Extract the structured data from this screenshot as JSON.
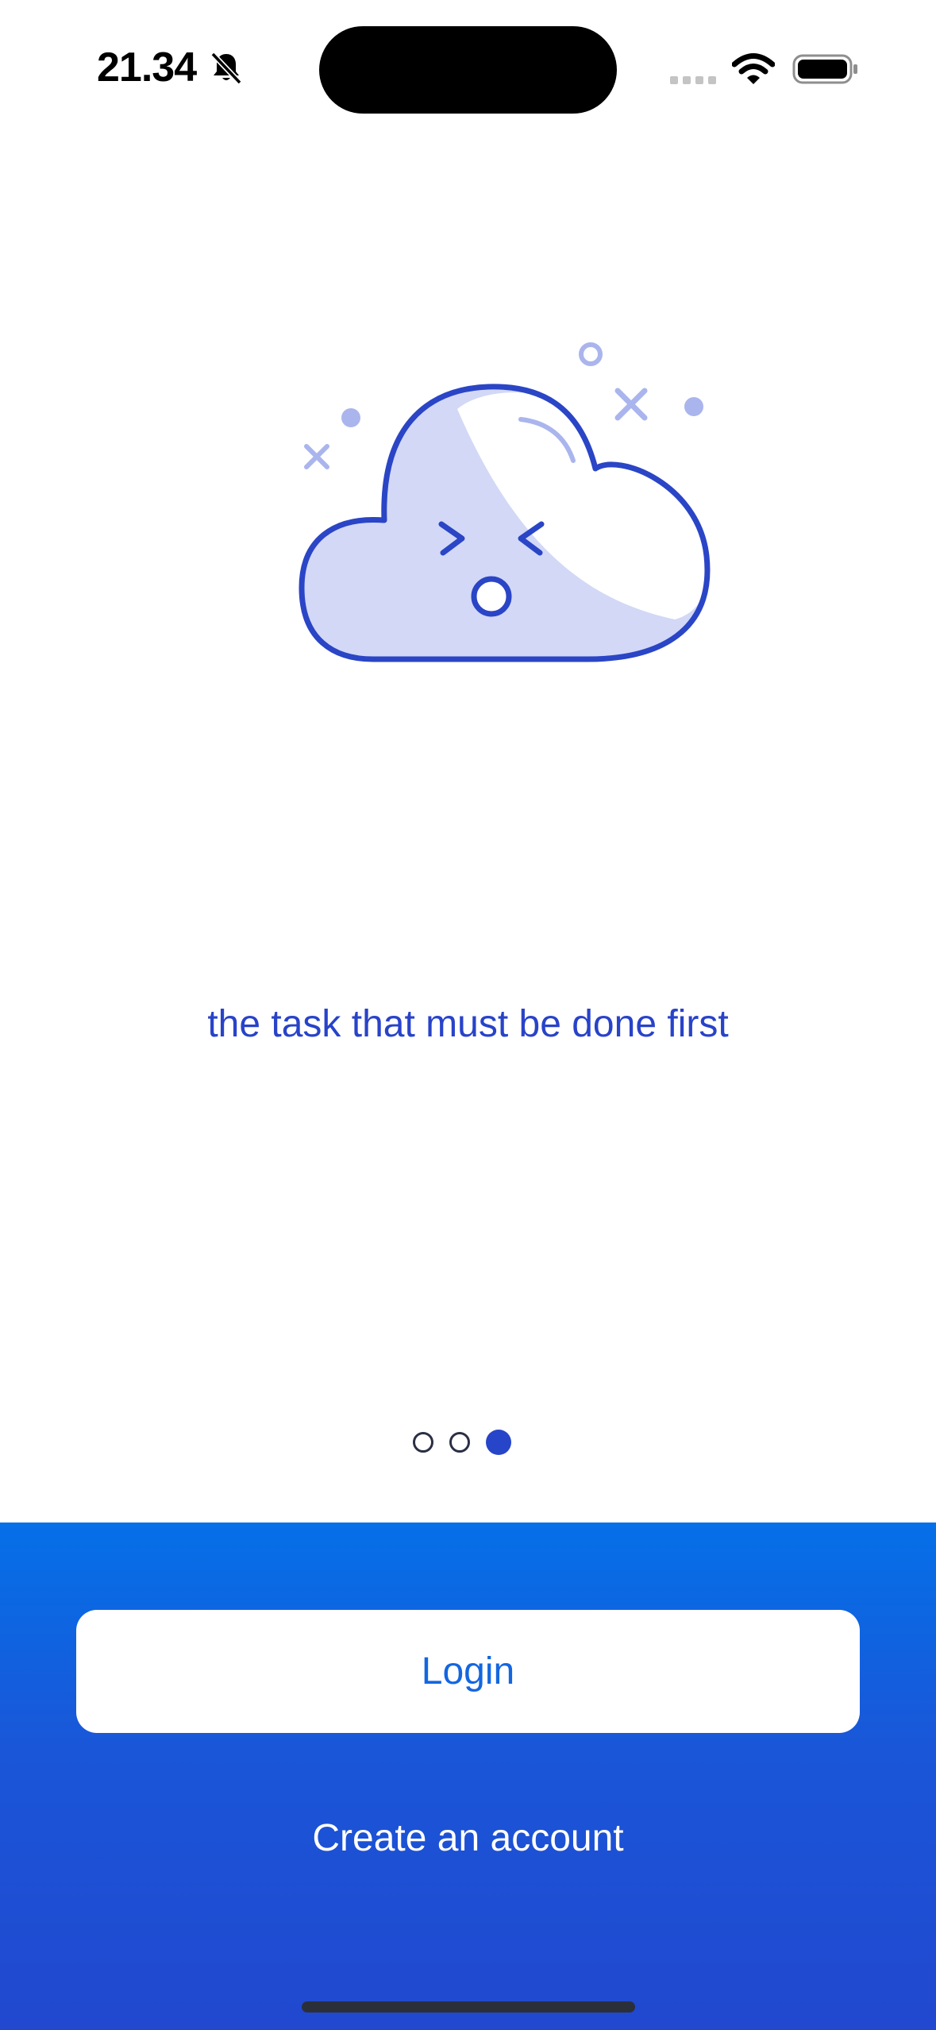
{
  "status_bar": {
    "time": "21.34",
    "icons": [
      "bell-slash-icon",
      "cellular-signal-icon",
      "wifi-icon",
      "battery-icon"
    ]
  },
  "onboarding": {
    "illustration": "sad-cloud-icon",
    "caption": "the task that must be done first",
    "page_count": 3,
    "active_page": 3
  },
  "actions": {
    "login_label": "Login",
    "create_account_label": "Create an account"
  },
  "colors": {
    "accent": "#2745c8",
    "panel_top": "#0570e8",
    "panel_bottom": "#2148cf",
    "illustration_fill": "#d2d8f6",
    "illustration_deco": "#aab5ee"
  }
}
